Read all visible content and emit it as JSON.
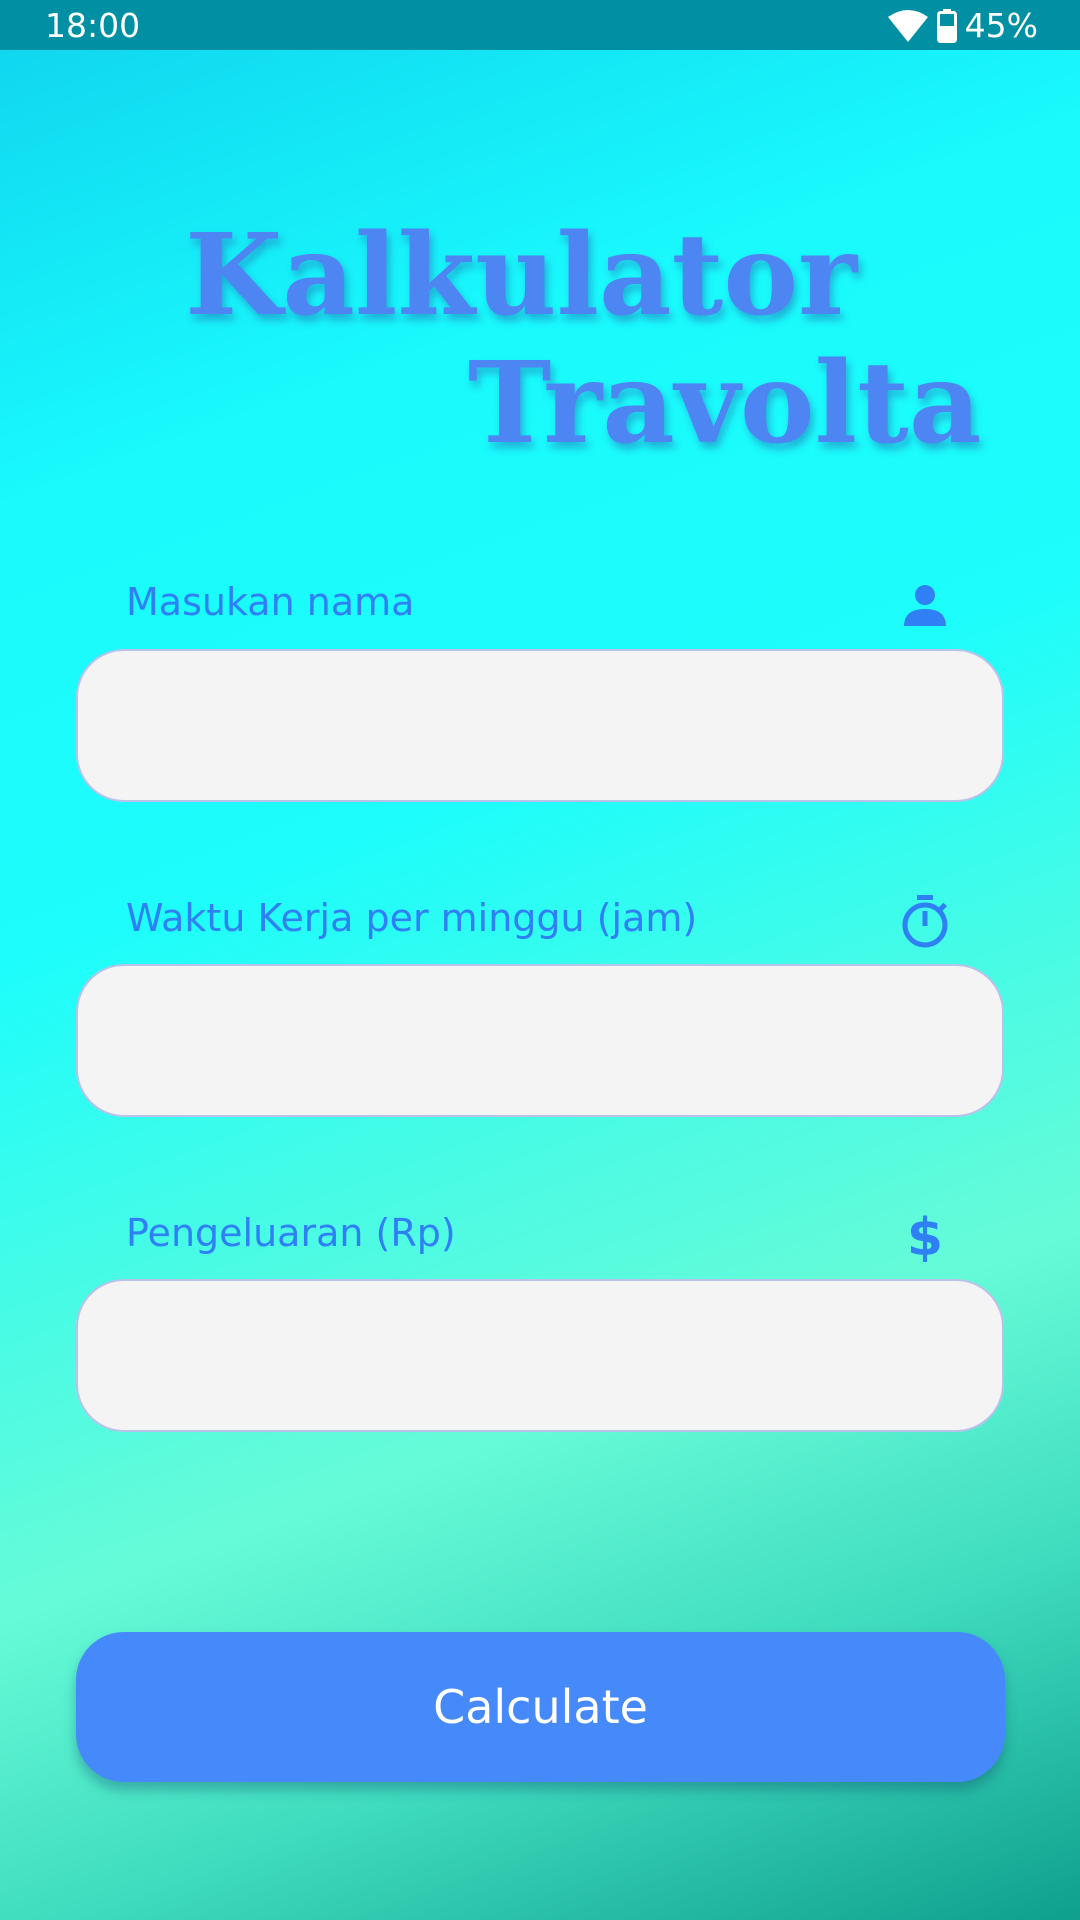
{
  "status_bar": {
    "time": "18:00",
    "battery": "45%",
    "icons": [
      "wifi-icon",
      "battery-icon"
    ]
  },
  "title": {
    "line1": "Kalkulator",
    "line2": "Travolta"
  },
  "form": {
    "name": {
      "label": "Masukan nama",
      "icon": "person-icon",
      "value": ""
    },
    "hours": {
      "label": "Waktu Kerja per minggu (jam)",
      "icon": "stopwatch-icon",
      "value": ""
    },
    "expense": {
      "label": "Pengeluaran (Rp)",
      "icon": "dollar-icon",
      "value": ""
    }
  },
  "button": {
    "label": "Calculate"
  },
  "colors": {
    "accent": "#4689fb",
    "label": "#2f7ff5",
    "title": "#4d86f2",
    "status_bar": "#0190a3"
  }
}
